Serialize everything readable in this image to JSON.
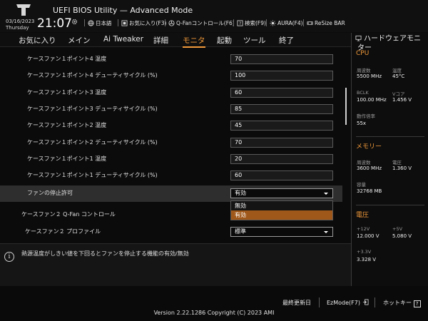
{
  "header": {
    "app_title": "UEFI BIOS Utility — Advanced Mode",
    "date": "03/16/2023",
    "day": "Thursday",
    "time": "21:07",
    "toolbar": [
      {
        "label": "日本語",
        "icon": "globe-icon"
      },
      {
        "label": "お気に入り(F3)",
        "icon": "favorites-icon"
      },
      {
        "label": "Q-Fanコントロール(F6)",
        "icon": "fan-icon"
      },
      {
        "label": "検索(F9)",
        "icon": "search-icon"
      },
      {
        "label": "AURA(F4)",
        "icon": "aura-icon"
      },
      {
        "label": "ReSize BAR",
        "icon": "resize-bar-icon"
      }
    ]
  },
  "menu": {
    "items": [
      "お気に入り",
      "メイン",
      "Ai Tweaker",
      "詳細",
      "モニタ",
      "起動",
      "ツール",
      "終了"
    ],
    "active": "モニタ"
  },
  "settings": {
    "rows": [
      {
        "label": "ケースファン１ポイント4 温度",
        "value": "70"
      },
      {
        "label": "ケースファン１ポイント4 デューティサイクル (%)",
        "value": "100"
      },
      {
        "label": "ケースファン１ポイント3 温度",
        "value": "60"
      },
      {
        "label": "ケースファン１ポイント3 デューティサイクル (%)",
        "value": "85"
      },
      {
        "label": "ケースファン１ポイント2 温度",
        "value": "45"
      },
      {
        "label": "ケースファン１ポイント2 デューティサイクル (%)",
        "value": "70"
      },
      {
        "label": "ケースファン１ポイント1 温度",
        "value": "20"
      },
      {
        "label": "ケースファン１ポイント1 デューティサイクル (%)",
        "value": "60"
      }
    ],
    "fan_stop": {
      "label": "ファンの停止許可",
      "value": "有効"
    },
    "fan_stop_options": [
      "無効",
      "有効"
    ],
    "case_fan2_control": {
      "label": "ケースファン２ Q-Fan コントロール"
    },
    "case_fan2_profile": {
      "label": "ケースファン２ プロファイル",
      "value": "標準"
    }
  },
  "info": {
    "text": "熱源温度がしきい値を下回るとファンを停止する機能の有効/無効"
  },
  "sidebar": {
    "title": "ハードウェアモニター",
    "cpu": {
      "title": "CPU",
      "freq_label": "周波数",
      "freq": "5500 MHz",
      "temp_label": "温度",
      "temp": "45°C",
      "bclk_label": "BCLK",
      "bclk": "100.00 MHz",
      "vcore_label": "Vコア",
      "vcore": "1.456 V",
      "ratio_label": "動作倍率",
      "ratio": "55x"
    },
    "memory": {
      "title": "メモリー",
      "freq_label": "周波数",
      "freq": "3600 MHz",
      "volt_label": "電圧",
      "volt": "1.360 V",
      "cap_label": "容量",
      "cap": "32768 MB"
    },
    "voltage": {
      "title": "電圧",
      "v12_label": "+12V",
      "v12": "12.000 V",
      "v5_label": "+5V",
      "v5": "5.080 V",
      "v33_label": "+3.3V",
      "v33": "3.328 V"
    }
  },
  "footer": {
    "last_modified": "最終更新日",
    "ezmode": "EzMode(F7)",
    "hotkeys": "ホットキー",
    "hotkeys_badge": "?",
    "version": "Version 2.22.1286 Copyright (C) 2023 AMI"
  },
  "colors": {
    "accent": "#f29a3a",
    "selected_option": "#a0581a",
    "background": "#0b0b0b"
  }
}
